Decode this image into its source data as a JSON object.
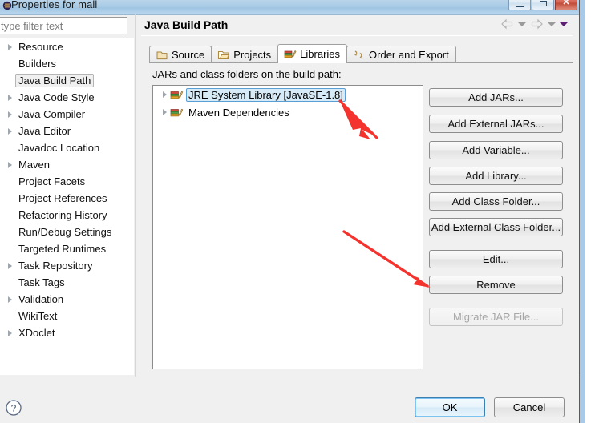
{
  "window": {
    "title": "Properties for mall",
    "controls": {
      "minimize": "Minimize",
      "maximize": "Maximize",
      "close": "Close"
    }
  },
  "filter": {
    "placeholder": "type filter text",
    "value": ""
  },
  "sidebar": {
    "items": [
      {
        "label": "Resource",
        "expandable": true,
        "selected": false
      },
      {
        "label": "Builders",
        "expandable": false,
        "selected": false
      },
      {
        "label": "Java Build Path",
        "expandable": false,
        "selected": true
      },
      {
        "label": "Java Code Style",
        "expandable": true,
        "selected": false
      },
      {
        "label": "Java Compiler",
        "expandable": true,
        "selected": false
      },
      {
        "label": "Java Editor",
        "expandable": true,
        "selected": false
      },
      {
        "label": "Javadoc Location",
        "expandable": false,
        "selected": false
      },
      {
        "label": "Maven",
        "expandable": true,
        "selected": false
      },
      {
        "label": "Project Facets",
        "expandable": false,
        "selected": false
      },
      {
        "label": "Project References",
        "expandable": false,
        "selected": false
      },
      {
        "label": "Refactoring History",
        "expandable": false,
        "selected": false
      },
      {
        "label": "Run/Debug Settings",
        "expandable": false,
        "selected": false
      },
      {
        "label": "Targeted Runtimes",
        "expandable": false,
        "selected": false
      },
      {
        "label": "Task Repository",
        "expandable": true,
        "selected": false
      },
      {
        "label": "Task Tags",
        "expandable": false,
        "selected": false
      },
      {
        "label": "Validation",
        "expandable": true,
        "selected": false
      },
      {
        "label": "WikiText",
        "expandable": false,
        "selected": false
      },
      {
        "label": "XDoclet",
        "expandable": true,
        "selected": false
      }
    ]
  },
  "page": {
    "title": "Java Build Path",
    "nav": {
      "back_icon": "arrow-left-icon",
      "back_menu_icon": "chevron-down-icon",
      "forward_icon": "arrow-right-icon",
      "forward_menu_icon": "chevron-down-icon",
      "view_menu_icon": "chevron-down-icon"
    },
    "tabs": [
      {
        "label": "Source",
        "icon": "package-icon",
        "active": false
      },
      {
        "label": "Projects",
        "icon": "folder-icon",
        "active": false
      },
      {
        "label": "Libraries",
        "icon": "books-icon",
        "active": true
      },
      {
        "label": "Order and Export",
        "icon": "order-arrows-icon",
        "active": false
      }
    ],
    "section_label": "JARs and class folders on the build path:",
    "library_list": [
      {
        "label": "JRE System Library [JavaSE-1.8]",
        "icon": "books-icon",
        "expandable": true,
        "selected": true
      },
      {
        "label": "Maven Dependencies",
        "icon": "books-icon",
        "expandable": true,
        "selected": false
      }
    ],
    "buttons": [
      {
        "label": "Add JARs...",
        "enabled": true
      },
      {
        "label": "Add External JARs...",
        "enabled": true
      },
      {
        "label": "Add Variable...",
        "enabled": true
      },
      {
        "label": "Add Library...",
        "enabled": true
      },
      {
        "label": "Add Class Folder...",
        "enabled": true
      },
      {
        "label": "Add External Class Folder...",
        "enabled": true
      },
      {
        "label": "Edit...",
        "enabled": true
      },
      {
        "label": "Remove",
        "enabled": true
      },
      {
        "label": "Migrate JAR File...",
        "enabled": false
      }
    ]
  },
  "footer": {
    "help_icon": "help-circle-icon",
    "ok_label": "OK",
    "cancel_label": "Cancel"
  },
  "annotations": [
    {
      "name": "arrow-to-jre-library",
      "color": "#f5332e"
    },
    {
      "name": "arrow-to-remove-button",
      "color": "#f5332e"
    }
  ],
  "colors": {
    "accent": "#3c7fb1",
    "selection": "#d7eaf8",
    "annotation": "#f5332e",
    "titlebar": "#a9cbe6"
  }
}
